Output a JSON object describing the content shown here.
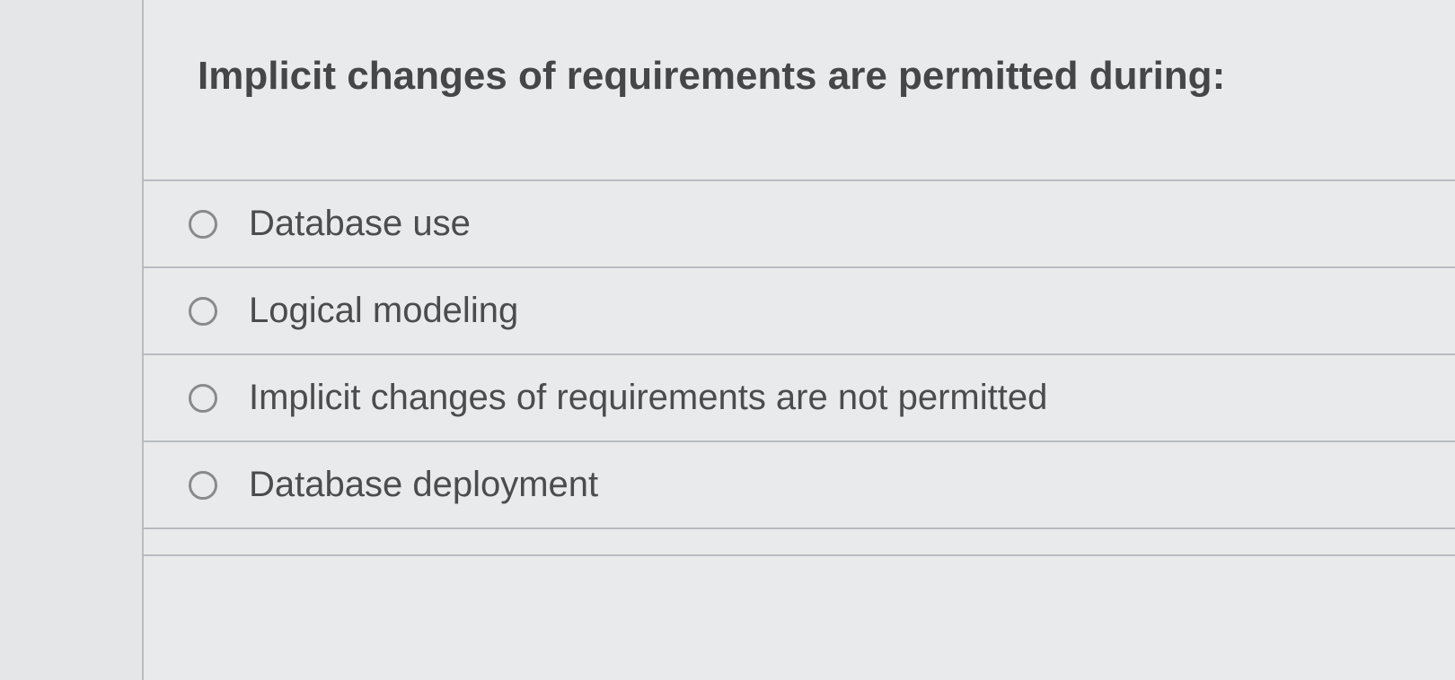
{
  "question": {
    "text": "Implicit changes of requirements are permitted during:",
    "options": [
      {
        "label": "Database use"
      },
      {
        "label": "Logical modeling"
      },
      {
        "label": "Implicit changes of requirements are not permitted"
      },
      {
        "label": "Database deployment"
      }
    ]
  }
}
